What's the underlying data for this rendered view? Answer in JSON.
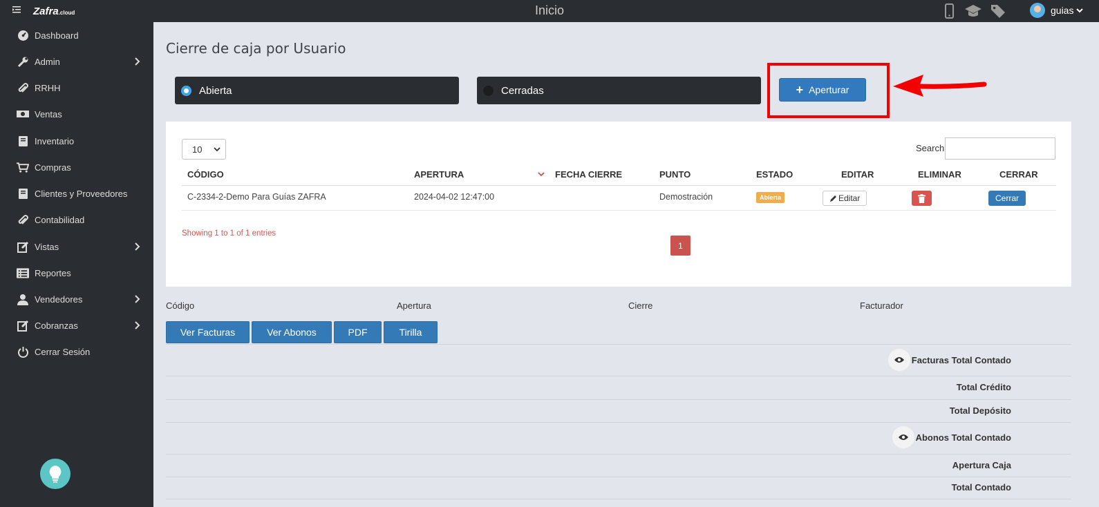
{
  "header": {
    "title": "Inicio",
    "logo": "Zafra",
    "logo_suffix": ".cloud",
    "username": "guias"
  },
  "sidebar": {
    "items": [
      {
        "label": "Dashboard"
      },
      {
        "label": "Admin"
      },
      {
        "label": "RRHH"
      },
      {
        "label": "Ventas"
      },
      {
        "label": "Inventario"
      },
      {
        "label": "Compras"
      },
      {
        "label": "Clientes y Proveedores"
      },
      {
        "label": "Contabilidad"
      },
      {
        "label": "Vistas"
      },
      {
        "label": "Reportes"
      },
      {
        "label": "Vendedores"
      },
      {
        "label": "Cobranzas"
      },
      {
        "label": "Cerrar Sesión"
      }
    ]
  },
  "page": {
    "title": "Cierre de caja por Usuario",
    "tab_open": "Abierta",
    "tab_closed": "Cerradas",
    "apertura_button": "Aperturar"
  },
  "table": {
    "page_length": "10",
    "search_label": "Search:",
    "search_value": "",
    "columns": [
      "CÓDIGO",
      "APERTURA",
      "FECHA CIERRE",
      "PUNTO",
      "ESTADO",
      "EDITAR",
      "ELIMINAR",
      "CERRAR"
    ],
    "rows": [
      {
        "codigo": "C-2334-2-Demo Para Guías ZAFRA",
        "apertura": "2024-04-02 12:47:00",
        "fecha_cierre": "",
        "punto": "Demostración",
        "estado": "Abierta",
        "editar": "Editar",
        "cerrar": "Cerrar"
      }
    ],
    "showing": "Showing 1 to 1 of 1 entries",
    "current_page": "1"
  },
  "info": {
    "codigo": "Código",
    "apertura": "Apertura",
    "cierre": "Cierre",
    "facturador": "Facturador"
  },
  "actions": {
    "ver_facturas": "Ver Facturas",
    "ver_abonos": "Ver Abonos",
    "pdf": "PDF",
    "tirilla": "Tirilla"
  },
  "summary": {
    "facturas_total_contado": "Facturas Total Contado",
    "total_credito": "Total Crédito",
    "total_deposito": "Total Depósito",
    "abonos_total_contado": "Abonos Total Contado",
    "apertura_caja": "Apertura Caja",
    "total_contado": "Total Contado"
  },
  "colors": {
    "sidebar_bg": "#2a2d31",
    "primary": "#337ab7",
    "danger": "#d9534f",
    "warning": "#f0ad4e",
    "highlight": "#f30000"
  }
}
